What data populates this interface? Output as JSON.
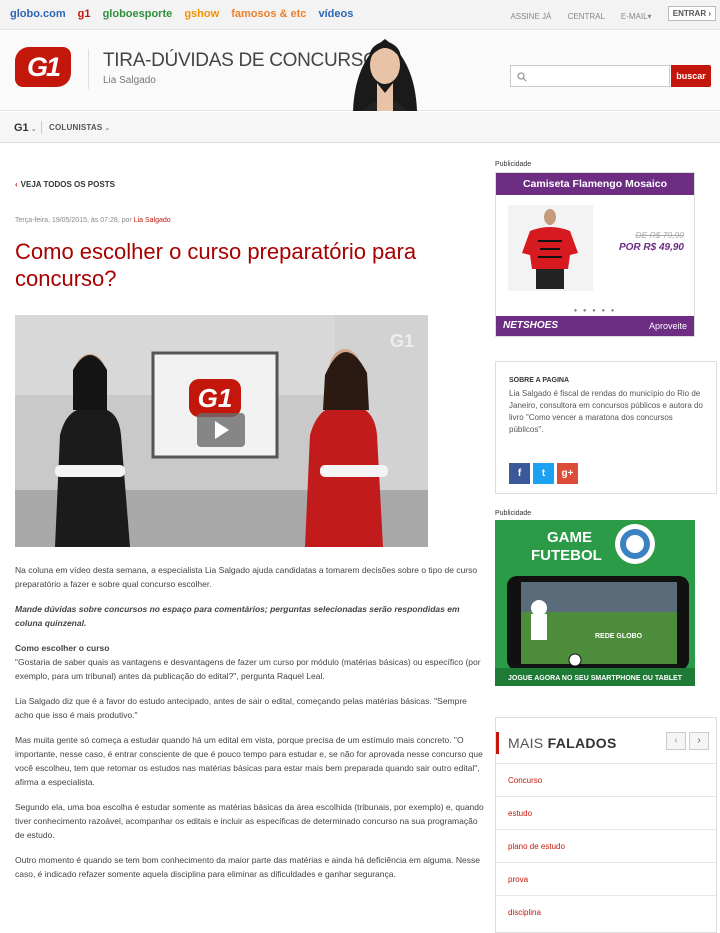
{
  "globobar": {
    "brands": [
      "globo.com",
      "g1",
      "globoesporte",
      "gshow",
      "famosos & etc",
      "vídeos"
    ],
    "links": [
      "ASSINE JÁ",
      "CENTRAL",
      "E-MAIL▾"
    ],
    "login_label": "ENTRAR ›"
  },
  "header": {
    "logo_text": "G1",
    "blog_title": "TIRA-DÚVIDAS DE CONCURSOS",
    "author": "Lia Salgado",
    "search_placeholder": "",
    "search_button": "buscar"
  },
  "nav": {
    "home_label": "G1",
    "colunistas_label": "COLUNISTAS"
  },
  "post": {
    "back_label": "VEJA TODOS OS POSTS",
    "meta_prefix": "Terça-feira, 19/05/2015, às 07:28, por ",
    "meta_author": "Lia Salgado",
    "title": "Como escolher o curso preparatório para concurso?",
    "video_logo": "G1",
    "paragraphs": {
      "p1": "Na coluna em vídeo desta semana, a especialista Lia Salgado ajuda candidatas a tomarem decisões sobre o tipo de curso preparatório a fazer e sobre qual concurso escolher.",
      "p2": "Mande dúvidas sobre concursos no espaço para comentários; perguntas selecionadas serão respondidas em coluna quinzenal.",
      "p3_head": "Como escolher o curso",
      "p3": "\"Gostaria de saber quais as vantagens e desvantagens de fazer um curso por módulo (matérias básicas) ou específico (por exemplo, para um tribunal) antes da publicação do edital?\", pergunta Raquel Leal.",
      "p4": "Lia Salgado diz que é a favor do estudo antecipado, antes de sair o edital, começando pelas matérias básicas. \"Sempre acho que isso é mais produtivo.\"",
      "p5": "Mas muita gente só começa a estudar quando há um edital em vista, porque precisa de um estímulo mais concreto. \"O importante, nesse caso, é entrar consciente de que é pouco tempo para estudar e, se não for aprovada nesse concurso que você escolheu, tem que retomar os estudos nas matérias básicas para estar mais bem preparada quando sair outro edital\", afirma a especialista.",
      "p6": "Segundo ela, uma boa escolha é estudar somente as matérias básicas da área escolhida (tribunais, por exemplo) e, quando tiver conhecimento razoável, acompanhar os editais e incluir as específicas de determinado concurso na sua programação de estudo.",
      "p7": "Outro momento é quando se tem bom conhecimento da maior parte das matérias e ainda há deficiência em alguma. Nesse caso, é indicado refazer somente aquela disciplina para eliminar as dificuldades e ganhar segurança."
    }
  },
  "sidebar": {
    "ad_label": "Publicidade",
    "ad1": {
      "title": "Camiseta Flamengo Mosaico",
      "old_price": "DE R$ 79,90",
      "new_price": "POR R$ 49,90",
      "brand": "NETSHOES",
      "cta": "Aproveite"
    },
    "about": {
      "heading": "SOBRE A PAGINA",
      "text": "Lia Salgado é fiscal de rendas do município do Rio de Janeiro, consultora em concursos públicos e autora do livro \"Como vencer a maratona dos concursos públicos\".",
      "social": [
        "f",
        "t",
        "g+"
      ]
    },
    "ad2": {
      "title_line1": "GAME",
      "title_line2": "FUTEBOL",
      "screen_text": "REDE GLOBO",
      "footer": "JOGUE AGORA NO SEU SMARTPHONE OU TABLET"
    },
    "falados": {
      "title_light": "MAIS ",
      "title_bold": "FALADOS",
      "items": [
        "Concurso",
        "estudo",
        "plano de estudo",
        "prova",
        "disciplina"
      ]
    }
  },
  "colors": {
    "g1_red": "#c4170c",
    "title_red": "#a80000",
    "netshoes_purple": "#6c2d83",
    "globo_green": "#2c9b48"
  }
}
